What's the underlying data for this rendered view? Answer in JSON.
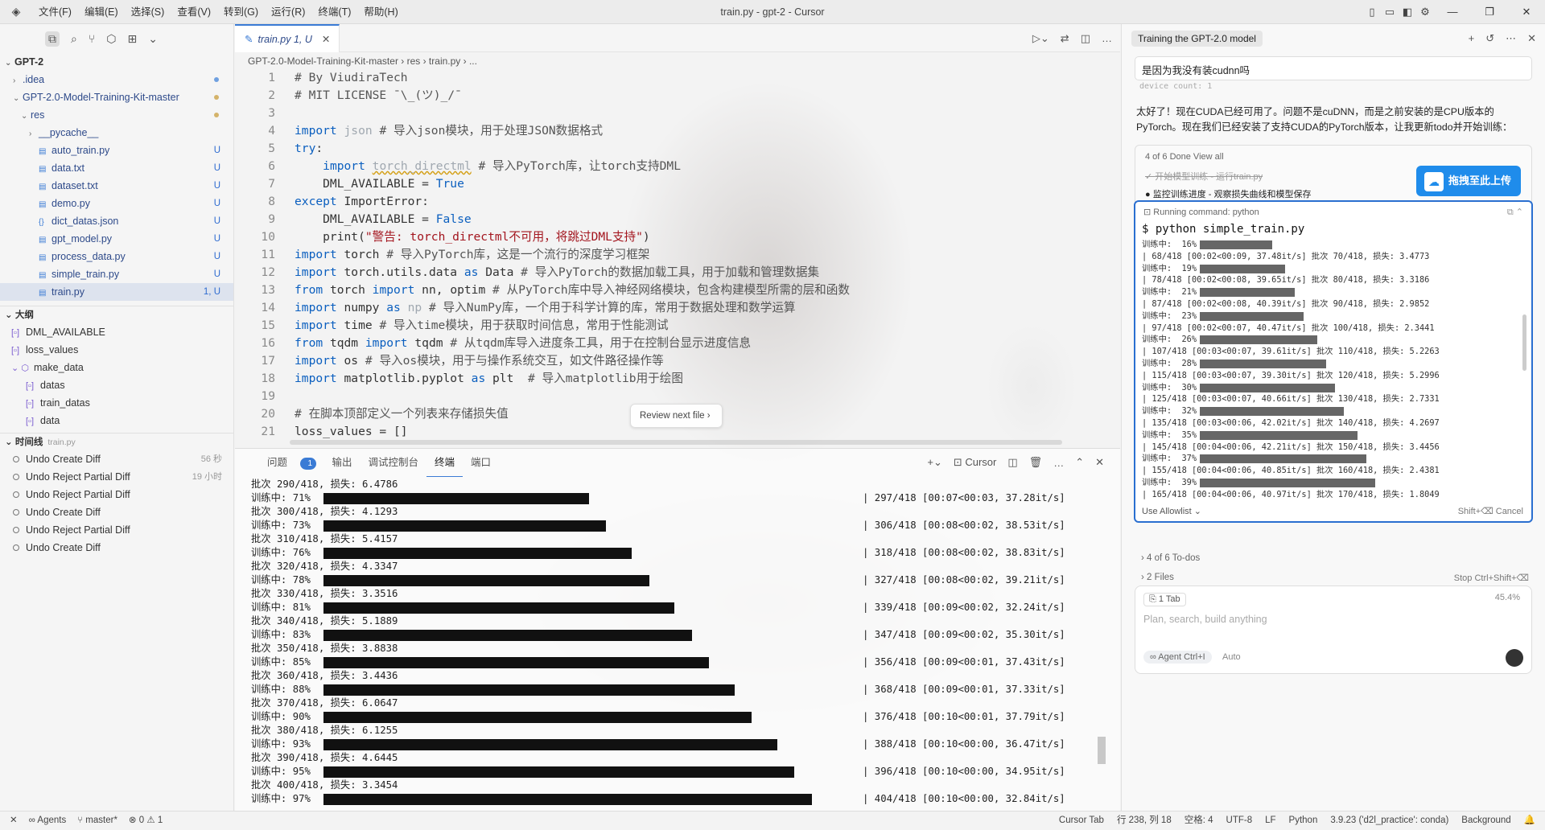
{
  "window": {
    "title": "train.py - gpt-2 - Cursor",
    "menu": [
      "文件(F)",
      "编辑(E)",
      "选择(S)",
      "查看(V)",
      "转到(G)",
      "运行(R)",
      "终端(T)",
      "帮助(H)"
    ]
  },
  "explorer": {
    "root": "GPT-2",
    "items": [
      {
        "label": ".idea",
        "depth": 1,
        "twisty": "›",
        "marker": "dot"
      },
      {
        "label": "GPT-2.0-Model-Training-Kit-master",
        "depth": 1,
        "twisty": "⌄",
        "marker": "doty"
      },
      {
        "label": "res",
        "depth": 2,
        "twisty": "⌄",
        "marker": "doty"
      },
      {
        "label": "__pycache__",
        "depth": 3,
        "twisty": "›",
        "marker": ""
      },
      {
        "label": "auto_train.py",
        "depth": 3,
        "twisty": "",
        "marker": "U"
      },
      {
        "label": "data.txt",
        "depth": 3,
        "twisty": "",
        "marker": "U"
      },
      {
        "label": "dataset.txt",
        "depth": 3,
        "twisty": "",
        "marker": "U"
      },
      {
        "label": "demo.py",
        "depth": 3,
        "twisty": "",
        "marker": "U"
      },
      {
        "label": "dict_datas.json",
        "depth": 3,
        "twisty": "",
        "marker": "U"
      },
      {
        "label": "gpt_model.py",
        "depth": 3,
        "twisty": "",
        "marker": "U"
      },
      {
        "label": "process_data.py",
        "depth": 3,
        "twisty": "",
        "marker": "U"
      },
      {
        "label": "simple_train.py",
        "depth": 3,
        "twisty": "",
        "marker": "U"
      },
      {
        "label": "train.py",
        "depth": 3,
        "twisty": "",
        "marker": "1, U"
      }
    ]
  },
  "outline": {
    "title": "大纲",
    "items": [
      {
        "label": "DML_AVAILABLE",
        "depth": 1
      },
      {
        "label": "loss_values",
        "depth": 1
      },
      {
        "label": "make_data",
        "depth": 1
      },
      {
        "label": "datas",
        "depth": 2
      },
      {
        "label": "train_datas",
        "depth": 2
      },
      {
        "label": "data",
        "depth": 2
      }
    ]
  },
  "timeline": {
    "title": "时间线",
    "file": "train.py",
    "items": [
      {
        "label": "Undo Create Diff",
        "when": "56 秒"
      },
      {
        "label": "Undo Reject Partial Diff",
        "when": "19 小时"
      },
      {
        "label": "Undo Reject Partial Diff",
        "when": ""
      },
      {
        "label": "Undo Create Diff",
        "when": ""
      },
      {
        "label": "Undo Reject Partial Diff",
        "when": ""
      },
      {
        "label": "Undo Create Diff",
        "when": ""
      }
    ]
  },
  "editor": {
    "tab": "train.py 1, U",
    "breadcrumb": "GPT-2.0-Model-Training-Kit-master  ›  res  ›  train.py  ›  ...",
    "review_button": "Review next file  ›",
    "lines": [
      "<span class=\"cm\"># By ViudiraTech</span>",
      "<span class=\"cm\"># MIT LICENSE ¯\\_(ツ)_/¯</span>",
      "",
      "<span class=\"kw\">import</span> <span class=\"dim\">json</span> <span class=\"cm\"># 导入json模块，用于处理JSON数据格式</span>",
      "<span class=\"kw\">try</span>:",
      "    <span class=\"kw\">import</span> <span class=\"dim und\">torch_directml</span> <span class=\"cm\"># 导入PyTorch库，让torch支持DML</span>",
      "    DML_AVAILABLE = <span class=\"kw\">True</span>",
      "<span class=\"kw\">except</span> ImportError:",
      "    DML_AVAILABLE = <span class=\"kw\">False</span>",
      "    print(<span class=\"st\">\"警告: torch_directml不可用，将跳过DML支持\"</span>)",
      "<span class=\"kw\">import</span> torch <span class=\"cm\"># 导入PyTorch库，这是一个流行的深度学习框架</span>",
      "<span class=\"kw\">import</span> torch.utils.data <span class=\"kw\">as</span> Data <span class=\"cm\"># 导入PyTorch的数据加载工具，用于加载和管理数据集</span>",
      "<span class=\"kw\">from</span> torch <span class=\"kw\">import</span> nn, optim <span class=\"cm\"># 从PyTorch库中导入神经网络模块，包含构建模型所需的层和函数</span>",
      "<span class=\"kw\">import</span> numpy <span class=\"kw\">as</span> <span class=\"dim\">np</span> <span class=\"cm\"># 导入NumPy库，一个用于科学计算的库，常用于数据处理和数学运算</span>",
      "<span class=\"kw\">import</span> time <span class=\"cm\"># 导入time模块，用于获取时间信息，常用于性能测试</span>",
      "<span class=\"kw\">from</span> tqdm <span class=\"kw\">import</span> tqdm <span class=\"cm\"># 从tqdm库导入进度条工具，用于在控制台显示进度信息</span>",
      "<span class=\"kw\">import</span> os <span class=\"cm\"># 导入os模块，用于与操作系统交互，如文件路径操作等</span>",
      "<span class=\"kw\">import</span> matplotlib.pyplot <span class=\"kw\">as</span> plt  <span class=\"cm\"># 导入matplotlib用于绘图</span>",
      "",
      "<span class=\"cm\"># 在脚本顶部定义一个列表来存储损失值</span>",
      "loss_values = []"
    ]
  },
  "panel": {
    "tabs": [
      "问题",
      "输出",
      "调试控制台",
      "终端",
      "端口"
    ],
    "problems_count": "1",
    "cursor_label": "Cursor",
    "terminal": [
      {
        "batch": "批次 290/418, 损失: 6.4786",
        "pct": "71%",
        "progress": 0.71,
        "rate": "| 297/418 [00:07<00:03, 37.28it/s]"
      },
      {
        "batch": "批次 300/418, 损失: 4.1293",
        "pct": "73%",
        "progress": 0.73,
        "rate": "| 306/418 [00:08<00:02, 38.53it/s]"
      },
      {
        "batch": "批次 310/418, 损失: 5.4157",
        "pct": "76%",
        "progress": 0.76,
        "rate": "| 318/418 [00:08<00:02, 38.83it/s]"
      },
      {
        "batch": "批次 320/418, 损失: 4.3347",
        "pct": "78%",
        "progress": 0.78,
        "rate": "| 327/418 [00:08<00:02, 39.21it/s]"
      },
      {
        "batch": "批次 330/418, 损失: 3.3516",
        "pct": "81%",
        "progress": 0.81,
        "rate": "| 339/418 [00:09<00:02, 32.24it/s]"
      },
      {
        "batch": "批次 340/418, 损失: 5.1889",
        "pct": "83%",
        "progress": 0.83,
        "rate": "| 347/418 [00:09<00:02, 35.30it/s]"
      },
      {
        "batch": "批次 350/418, 损失: 3.8838",
        "pct": "85%",
        "progress": 0.85,
        "rate": "| 356/418 [00:09<00:01, 37.43it/s]"
      },
      {
        "batch": "批次 360/418, 损失: 3.4436",
        "pct": "88%",
        "progress": 0.88,
        "rate": "| 368/418 [00:09<00:01, 37.33it/s]"
      },
      {
        "batch": "批次 370/418, 损失: 6.0647",
        "pct": "90%",
        "progress": 0.9,
        "rate": "| 376/418 [00:10<00:01, 37.79it/s]"
      },
      {
        "batch": "批次 380/418, 损失: 6.1255",
        "pct": "93%",
        "progress": 0.93,
        "rate": "| 388/418 [00:10<00:00, 36.47it/s]"
      },
      {
        "batch": "批次 390/418, 损失: 4.6445",
        "pct": "95%",
        "progress": 0.95,
        "rate": "| 396/418 [00:10<00:00, 34.95it/s]"
      },
      {
        "batch": "批次 400/418, 损失: 3.3454",
        "pct": "97%",
        "progress": 0.97,
        "rate": "| 404/418 [00:10<00:00, 32.84it/s]"
      }
    ],
    "training_label": "训练中:"
  },
  "ai": {
    "title": "Training the GPT-2.0 model",
    "user_question": "是因为我没有装cudnn吗",
    "prev_output": "device count: 1",
    "message": "太好了！现在CUDA已经可用了。问题不是cuDNN，而是之前安装的是CPU版本的PyTorch。现在我们已经安装了支持CUDA的PyTorch版本，让我更新todo并开始训练：",
    "todo_header": "4 of 6 Done  View all",
    "todo_done": "开始模型训练 - 运行train.py",
    "todo_current": "监控训练进度 - 观察损失曲线和模型保存",
    "upload_button": "拖拽至此上传",
    "cmd_header": "Running command: python",
    "command": "$ python simple_train.py",
    "cmd_output": [
      {
        "t": "训练中:  16%",
        "progress": 0.16
      },
      {
        "t": "| 68/418 [00:02<00:09, 37.48it/s] 批次 70/418, 损失: 3.4773"
      },
      {
        "t": "训练中:  19%",
        "progress": 0.19
      },
      {
        "t": "| 78/418 [00:02<00:08, 39.65it/s] 批次 80/418, 损失: 3.3186"
      },
      {
        "t": "训练中:  21%",
        "progress": 0.21
      },
      {
        "t": "| 87/418 [00:02<00:08, 40.39it/s] 批次 90/418, 损失: 2.9852"
      },
      {
        "t": "训练中:  23%",
        "progress": 0.23
      },
      {
        "t": "| 97/418 [00:02<00:07, 40.47it/s] 批次 100/418, 损失: 2.3441"
      },
      {
        "t": "训练中:  26%",
        "progress": 0.26
      },
      {
        "t": "| 107/418 [00:03<00:07, 39.61it/s] 批次 110/418, 损失: 5.2263"
      },
      {
        "t": "训练中:  28%",
        "progress": 0.28
      },
      {
        "t": "| 115/418 [00:03<00:07, 39.30it/s] 批次 120/418, 损失: 5.2996"
      },
      {
        "t": "训练中:  30%",
        "progress": 0.3
      },
      {
        "t": "| 125/418 [00:03<00:07, 40.66it/s] 批次 130/418, 损失: 2.7331"
      },
      {
        "t": "训练中:  32%",
        "progress": 0.32
      },
      {
        "t": "| 135/418 [00:03<00:06, 42.02it/s] 批次 140/418, 损失: 4.2697"
      },
      {
        "t": "训练中:  35%",
        "progress": 0.35
      },
      {
        "t": "| 145/418 [00:04<00:06, 42.21it/s] 批次 150/418, 损失: 3.4456"
      },
      {
        "t": "训练中:  37%",
        "progress": 0.37
      },
      {
        "t": "| 155/418 [00:04<00:06, 40.85it/s] 批次 160/418, 损失: 2.4381"
      },
      {
        "t": "训练中:  39%",
        "progress": 0.39
      },
      {
        "t": "| 165/418 [00:04<00:06, 40.97it/s] 批次 170/418, 损失: 1.8049"
      }
    ],
    "allowlist": "Use Allowlist ⌄",
    "cancel": "Shift+⌫ Cancel",
    "todos_line": "›  4 of 6 To-dos",
    "files_line": "›  2 Files",
    "stop": "Stop Ctrl+Shift+⌫",
    "tab_chip": "⎘ 1 Tab",
    "context_pct": "45.4%",
    "placeholder": "Plan, search, build anything",
    "agent_chip": "∞ Agent Ctrl+I",
    "auto": "Auto"
  },
  "status": {
    "left": [
      "✕",
      "∞ Agents",
      "⑂ master*",
      "⊗ 0 ⚠ 1"
    ],
    "right": [
      "Cursor Tab",
      "行 238, 列 18",
      "空格: 4",
      "UTF-8",
      "LF",
      "Python",
      "3.9.23 ('d2l_practice': conda)",
      "Background",
      "🔔"
    ]
  },
  "colors": {
    "accent": "#3a7bd5",
    "upload": "#1f8ceb",
    "keyword": "#0b5fbf",
    "string": "#a3151e"
  }
}
